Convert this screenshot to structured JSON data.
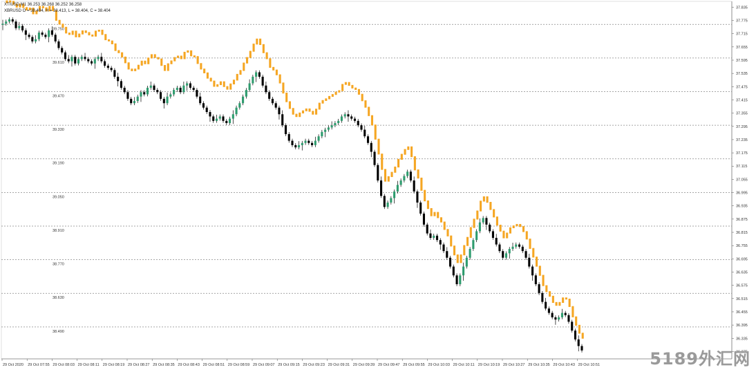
{
  "header": {
    "line1": "XTIUSD,M1  36.253 36.268 36.252 36.258",
    "line2": "XBRUSD O = 38.404, H = 38.413, L = 38.404, C = 38.404"
  },
  "watermark": "5189外汇网",
  "colors": {
    "up": "#2e9c6e",
    "down": "#000000",
    "overlay": "#f5a623",
    "grid": "#888888",
    "frame": "#cccccc"
  },
  "chart_data": {
    "type": "candlestick",
    "x_tick_labels": [
      "29 Oct 2020",
      "29 Oct 07:55",
      "29 Oct 08:03",
      "29 Oct 08:11",
      "29 Oct 08:19",
      "29 Oct 08:27",
      "29 Oct 08:35",
      "29 Oct 08:43",
      "29 Oct 08:51",
      "29 Oct 08:59",
      "29 Oct 09:07",
      "29 Oct 09:15",
      "29 Oct 09:23",
      "29 Oct 09:31",
      "29 Oct 09:39",
      "29 Oct 09:47",
      "29 Oct 09:55",
      "29 Oct 10:03",
      "29 Oct 10:11",
      "29 Oct 10:19",
      "29 Oct 10:27",
      "29 Oct 10:35",
      "29 Oct 10:43",
      "29 Oct 10:51"
    ],
    "right_axis": {
      "symbol": "XTIUSD",
      "ticks": [
        "37.835",
        "37.775",
        "37.715",
        "37.655",
        "37.595",
        "37.535",
        "37.475",
        "37.415",
        "37.355",
        "37.295",
        "37.235",
        "37.175",
        "37.115",
        "37.055",
        "36.995",
        "36.935",
        "36.875",
        "36.815",
        "36.755",
        "36.695",
        "36.635",
        "36.575",
        "36.515",
        "36.455",
        "36.395",
        "36.335",
        "36.275"
      ],
      "ylim": [
        36.245,
        37.855
      ]
    },
    "left_axis": {
      "symbol": "XBRUSD",
      "ticks": [
        "39.750",
        "39.610",
        "39.470",
        "39.330",
        "39.190",
        "39.050",
        "38.910",
        "38.770",
        "38.630",
        "38.490"
      ],
      "ylim": [
        38.36,
        39.84
      ]
    },
    "series": [
      {
        "name": "XTIUSD",
        "style": "candles",
        "close": [
          37.76,
          37.77,
          37.78,
          37.77,
          37.74,
          37.75,
          37.73,
          37.71,
          37.7,
          37.68,
          37.69,
          37.72,
          37.71,
          37.7,
          37.73,
          37.71,
          37.68,
          37.65,
          37.63,
          37.6,
          37.59,
          37.61,
          37.58,
          37.6,
          37.61,
          37.6,
          37.59,
          37.58,
          37.6,
          37.61,
          37.59,
          37.57,
          37.56,
          37.55,
          37.52,
          37.5,
          37.47,
          37.45,
          37.42,
          37.4,
          37.41,
          37.43,
          37.45,
          37.44,
          37.47,
          37.48,
          37.46,
          37.45,
          37.42,
          37.4,
          37.43,
          37.44,
          37.46,
          37.47,
          37.45,
          37.48,
          37.49,
          37.47,
          37.46,
          37.43,
          37.4,
          37.38,
          37.36,
          37.34,
          37.32,
          37.33,
          37.34,
          37.32,
          37.31,
          37.33,
          37.35,
          37.38,
          37.4,
          37.43,
          37.46,
          37.49,
          37.52,
          37.54,
          37.52,
          37.48,
          37.45,
          37.42,
          37.4,
          37.38,
          37.35,
          37.3,
          37.26,
          37.23,
          37.21,
          37.2,
          37.21,
          37.22,
          37.23,
          37.22,
          37.21,
          37.23,
          37.25,
          37.27,
          37.28,
          37.29,
          37.3,
          37.31,
          37.32,
          37.34,
          37.35,
          37.34,
          37.33,
          37.32,
          37.3,
          37.28,
          37.25,
          37.22,
          37.18,
          37.12,
          37.05,
          36.98,
          36.93,
          36.95,
          36.97,
          37.0,
          37.03,
          37.05,
          37.07,
          37.09,
          37.05,
          37.0,
          36.95,
          36.9,
          36.85,
          36.81,
          36.79,
          36.8,
          36.78,
          36.76,
          36.73,
          36.7,
          36.66,
          36.62,
          36.58,
          36.62,
          36.66,
          36.7,
          36.74,
          36.78,
          36.82,
          36.86,
          36.88,
          36.85,
          36.82,
          36.79,
          36.76,
          36.73,
          36.7,
          36.72,
          36.74,
          36.75,
          36.76,
          36.75,
          36.73,
          36.7,
          36.66,
          36.62,
          36.58,
          36.54,
          36.5,
          36.47,
          36.45,
          36.43,
          36.42,
          36.43,
          36.45,
          36.44,
          36.41,
          36.37,
          36.33,
          36.3,
          36.28
        ]
      },
      {
        "name": "XBRUSD",
        "style": "overlay-bars",
        "close": [
          39.84,
          39.848,
          39.846,
          39.834,
          39.822,
          39.834,
          39.82,
          39.81,
          39.818,
          39.794,
          39.806,
          39.825,
          39.819,
          39.806,
          39.825,
          39.807,
          39.767,
          39.751,
          39.738,
          39.714,
          39.708,
          39.722,
          39.698,
          39.71,
          39.723,
          39.716,
          39.706,
          39.701,
          39.722,
          39.726,
          39.708,
          39.686,
          39.681,
          39.669,
          39.641,
          39.632,
          39.614,
          39.59,
          39.564,
          39.557,
          39.564,
          39.58,
          39.597,
          39.586,
          39.61,
          39.624,
          39.612,
          39.606,
          39.579,
          39.558,
          39.586,
          39.598,
          39.612,
          39.618,
          39.607,
          39.634,
          39.64,
          39.619,
          39.616,
          39.587,
          39.564,
          39.548,
          39.526,
          39.514,
          39.492,
          39.499,
          39.511,
          39.491,
          39.48,
          39.502,
          39.518,
          39.542,
          39.558,
          39.589,
          39.612,
          39.638,
          39.668,
          39.689,
          39.666,
          39.632,
          39.607,
          39.571,
          39.56,
          39.54,
          39.506,
          39.464,
          39.428,
          39.4,
          39.376,
          39.366,
          39.381,
          39.39,
          39.398,
          39.388,
          39.376,
          39.397,
          39.422,
          39.433,
          39.44,
          39.45,
          39.458,
          39.468,
          39.474,
          39.5,
          39.508,
          39.496,
          39.485,
          39.479,
          39.459,
          39.432,
          39.405,
          39.37,
          39.331,
          39.272,
          39.21,
          39.146,
          39.097,
          39.116,
          39.134,
          39.156,
          39.188,
          39.209,
          39.229,
          39.24,
          39.199,
          39.144,
          39.11,
          39.059,
          39.015,
          38.983,
          38.953,
          38.967,
          38.945,
          38.927,
          38.896,
          38.869,
          38.827,
          38.79,
          38.758,
          38.79,
          38.829,
          38.863,
          38.904,
          38.939,
          38.973,
          39.014,
          39.032,
          39.009,
          38.979,
          38.948,
          38.914,
          38.889,
          38.861,
          38.881,
          38.903,
          38.911,
          38.917,
          38.908,
          38.887,
          38.856,
          38.817,
          38.781,
          38.743,
          38.705,
          38.662,
          38.637,
          38.618,
          38.592,
          38.58,
          38.592,
          38.611,
          38.606,
          38.575,
          38.532,
          38.497,
          38.464,
          38.443
        ]
      }
    ]
  }
}
